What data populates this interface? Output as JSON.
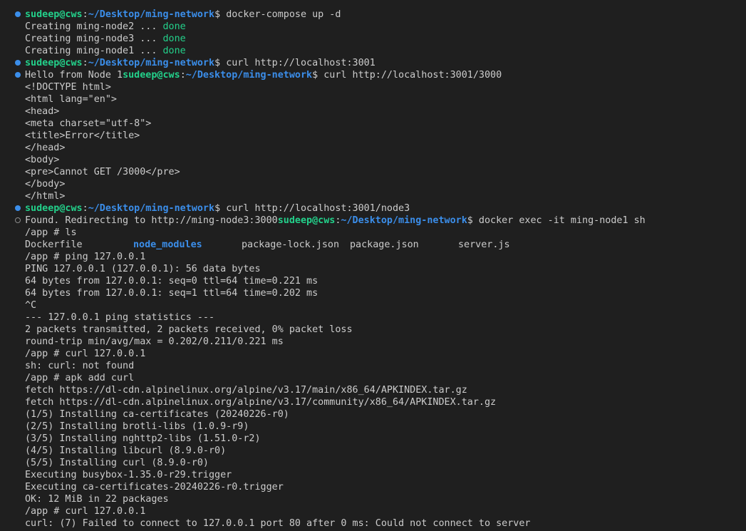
{
  "terminal": {
    "prompt_user": "sudeep@cws",
    "prompt_path": "~/Desktop/ming-network",
    "line01": {
      "cmd": "docker-compose up -d"
    },
    "line02": {
      "text": "Creating ming-node2 ... ",
      "status": "done"
    },
    "line03": {
      "text": "Creating ming-node3 ... ",
      "status": "done"
    },
    "line04": {
      "text": "Creating ming-node1 ... ",
      "status": "done"
    },
    "line05": {
      "cmd": "curl http://localhost:3001"
    },
    "line06": {
      "pre": "Hello from Node 1",
      "cmd": "curl http://localhost:3001/3000"
    },
    "line07": "<!DOCTYPE html>",
    "line08": "<html lang=\"en\">",
    "line09": "<head>",
    "line10": "<meta charset=\"utf-8\">",
    "line11": "<title>Error</title>",
    "line12": "</head>",
    "line13": "<body>",
    "line14": "<pre>Cannot GET /3000</pre>",
    "line15": "</body>",
    "line16": "</html>",
    "line17": {
      "cmd": "curl http://localhost:3001/node3"
    },
    "line18": {
      "pre": "Found. Redirecting to http://ming-node3:3000",
      "cmd": "docker exec -it ming-node1 sh"
    },
    "line19": "/app # ls",
    "line20": {
      "f1": "Dockerfile",
      "f2": "node_modules",
      "f3": "package-lock.json",
      "f4": "package.json",
      "f5": "server.js"
    },
    "line21": "/app # ping 127.0.0.1",
    "line22": "PING 127.0.0.1 (127.0.0.1): 56 data bytes",
    "line23": "64 bytes from 127.0.0.1: seq=0 ttl=64 time=0.221 ms",
    "line24": "64 bytes from 127.0.0.1: seq=1 ttl=64 time=0.202 ms",
    "line25": "^C",
    "line26": "--- 127.0.0.1 ping statistics ---",
    "line27": "2 packets transmitted, 2 packets received, 0% packet loss",
    "line28": "round-trip min/avg/max = 0.202/0.211/0.221 ms",
    "line29": "/app # curl 127.0.0.1",
    "line30": "sh: curl: not found",
    "line31": "/app # apk add curl",
    "line32": "fetch https://dl-cdn.alpinelinux.org/alpine/v3.17/main/x86_64/APKINDEX.tar.gz",
    "line33": "fetch https://dl-cdn.alpinelinux.org/alpine/v3.17/community/x86_64/APKINDEX.tar.gz",
    "line34": "(1/5) Installing ca-certificates (20240226-r0)",
    "line35": "(2/5) Installing brotli-libs (1.0.9-r9)",
    "line36": "(3/5) Installing nghttp2-libs (1.51.0-r2)",
    "line37": "(4/5) Installing libcurl (8.9.0-r0)",
    "line38": "(5/5) Installing curl (8.9.0-r0)",
    "line39": "Executing busybox-1.35.0-r29.trigger",
    "line40": "Executing ca-certificates-20240226-r0.trigger",
    "line41": "OK: 12 MiB in 22 packages",
    "line42": "/app # curl 127.0.0.1",
    "line43": "curl: (7) Failed to connect to 127.0.0.1 port 80 after 0 ms: Could not connect to server"
  }
}
